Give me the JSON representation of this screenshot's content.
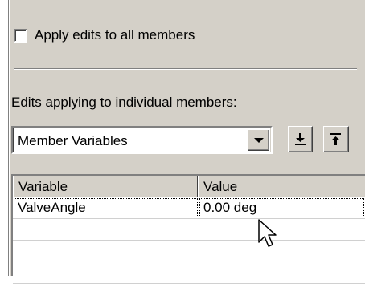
{
  "apply_all": {
    "label": "Apply edits to all members",
    "checked": false
  },
  "section_label": "Edits applying to individual members:",
  "member_select": {
    "value": "Member Variables"
  },
  "toolbar": {
    "import_icon": "download-icon",
    "export_icon": "upload-icon"
  },
  "grid": {
    "columns": [
      "Variable",
      "Value"
    ],
    "rows": [
      {
        "variable": "ValveAngle",
        "value": "0.00 deg"
      },
      {
        "variable": "",
        "value": ""
      },
      {
        "variable": "",
        "value": ""
      },
      {
        "variable": "",
        "value": ""
      }
    ]
  },
  "colors": {
    "panel": "#d4d0c8",
    "shadow": "#808080",
    "highlight": "#ffffff"
  }
}
